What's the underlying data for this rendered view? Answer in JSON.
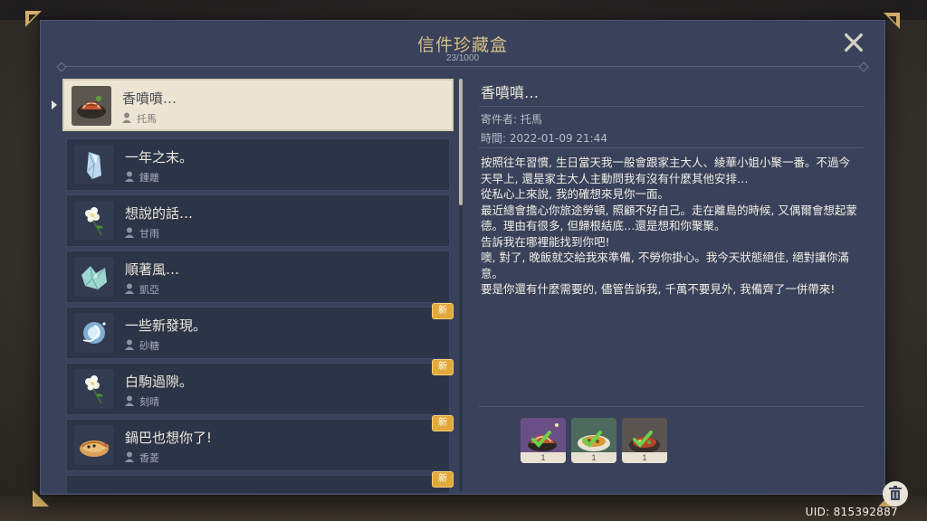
{
  "header": {
    "title": "信件珍藏盒",
    "count": "23/1000"
  },
  "letters": [
    {
      "title": "香噴噴…",
      "sender": "托馬",
      "icon": "grilled-meat-icon",
      "new": false,
      "selected": true
    },
    {
      "title": "一年之末。",
      "sender": "鍾離",
      "icon": "crystal-icon",
      "new": false,
      "selected": false
    },
    {
      "title": "想說的話…",
      "sender": "甘雨",
      "icon": "qingxin-flower-icon",
      "new": false,
      "selected": false
    },
    {
      "title": "順著風…",
      "sender": "凱亞",
      "icon": "crystal-chunk-icon",
      "new": false,
      "selected": false
    },
    {
      "title": "一些新發現。",
      "sender": "砂糖",
      "icon": "anemo-orb-icon",
      "new": true,
      "selected": false
    },
    {
      "title": "白駒過隙。",
      "sender": "刻晴",
      "icon": "qingxin-flower-icon",
      "new": true,
      "selected": false
    },
    {
      "title": "鍋巴也想你了!",
      "sender": "香菱",
      "icon": "guoba-icon",
      "new": true,
      "selected": false
    }
  ],
  "new_badge": "新",
  "detail": {
    "title": "香噴噴…",
    "sender": "寄件者: 托馬",
    "time": "時間: 2022-01-09 21:44",
    "body": [
      "按照往年習慣, 生日當天我一般會跟家主大人、綾華小姐小聚一番。不過今天早上, 還是家主大人主動問我有沒有什麼其他安排…",
      "從私心上來說, 我的確想來見你一面。",
      "最近總會擔心你旅途勞頓, 照顧不好自己。走在離島的時候, 又偶爾會想起蒙德。理由有很多, 但歸根結底…還是想和你聚聚。",
      "告訴我在哪裡能找到你吧!",
      "噢, 對了, 晚飯就交給我來準備, 不勞你掛心。我今天狀態絕佳, 絕對讓你滿意。",
      "要是你還有什麼需要的, 儘管告訴我, 千萬不要見外, 我備齊了一併帶來!"
    ],
    "attachments": [
      {
        "icon": "grilled-meat-icon",
        "qty": "1",
        "claimed": true
      },
      {
        "icon": "curry-dish-icon",
        "qty": "1",
        "claimed": true
      },
      {
        "icon": "hotpot-icon",
        "qty": "1",
        "claimed": true
      }
    ]
  },
  "footer": {
    "uid": "UID: 815392887"
  }
}
